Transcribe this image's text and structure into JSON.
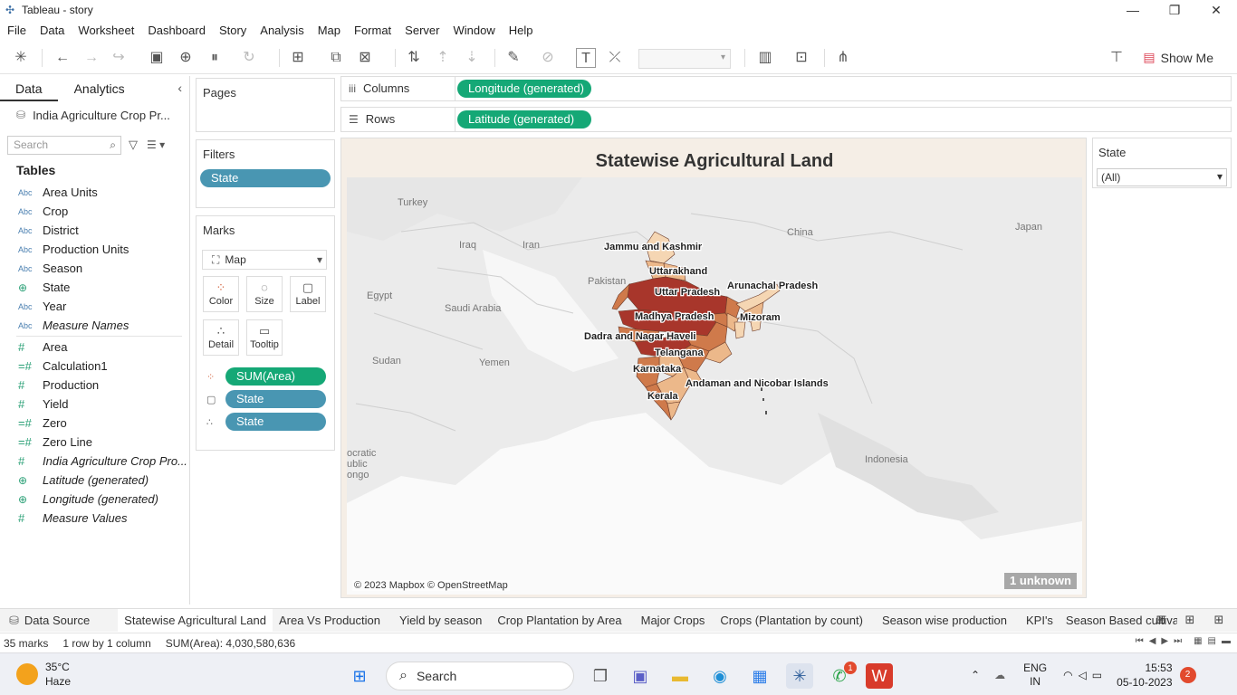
{
  "window": {
    "title": "Tableau - story"
  },
  "menu": [
    "File",
    "Data",
    "Worksheet",
    "Dashboard",
    "Story",
    "Analysis",
    "Map",
    "Format",
    "Server",
    "Window",
    "Help"
  ],
  "toolbar": {
    "show_me": "Show Me"
  },
  "datapane": {
    "tabs": [
      "Data",
      "Analytics"
    ],
    "datasource": "India Agriculture Crop Pr...",
    "search_placeholder": "Search",
    "tables_header": "Tables",
    "dimensions": [
      {
        "type": "Abc",
        "name": "Area Units"
      },
      {
        "type": "Abc",
        "name": "Crop"
      },
      {
        "type": "Abc",
        "name": "District"
      },
      {
        "type": "Abc",
        "name": "Production Units"
      },
      {
        "type": "Abc",
        "name": "Season"
      },
      {
        "type": "geo",
        "name": "State"
      },
      {
        "type": "Abc",
        "name": "Year"
      },
      {
        "type": "Abc",
        "name": "Measure Names",
        "italic": true
      }
    ],
    "measures": [
      {
        "type": "#",
        "name": "Area"
      },
      {
        "type": "=#",
        "name": "Calculation1"
      },
      {
        "type": "#",
        "name": "Production"
      },
      {
        "type": "#",
        "name": "Yield"
      },
      {
        "type": "=#",
        "name": "Zero"
      },
      {
        "type": "=#",
        "name": "Zero Line"
      },
      {
        "type": "#",
        "name": "India Agriculture Crop Pro...",
        "italic": true
      },
      {
        "type": "geo",
        "name": "Latitude (generated)",
        "italic": true
      },
      {
        "type": "geo",
        "name": "Longitude (generated)",
        "italic": true
      },
      {
        "type": "#",
        "name": "Measure Values",
        "italic": true
      }
    ]
  },
  "pages": {
    "label": "Pages"
  },
  "filters": {
    "label": "Filters",
    "pill": "State"
  },
  "marks": {
    "label": "Marks",
    "type": "Map",
    "buttons": [
      "Color",
      "Size",
      "Label",
      "Detail",
      "Tooltip"
    ],
    "pills": [
      "SUM(Area)",
      "State",
      "State"
    ]
  },
  "shelves": {
    "columns_label": "Columns",
    "columns_pill": "Longitude (generated)",
    "rows_label": "Rows",
    "rows_pill": "Latitude (generated)"
  },
  "viz": {
    "title": "Statewise Agricultural  Land",
    "credit": "© 2023 Mapbox © OpenStreetMap",
    "unknown": "1 unknown",
    "bg_labels": [
      "Turkey",
      "Iraq",
      "Iran",
      "Egypt",
      "Saudi Arabia",
      "Pakistan",
      "China",
      "Japan",
      "Sudan",
      "Yemen",
      "Indonesia",
      "ocratic",
      "ublic",
      "ongo"
    ],
    "state_labels": [
      "Jammu and Kashmir",
      "Uttarakhand",
      "Uttar Pradesh",
      "Arunachal Pradesh",
      "Madhya Pradesh",
      "Mizoram",
      "Dadra and Nagar Haveli",
      "Telangana",
      "Karnataka",
      "Andaman and Nicobar Islands",
      "Kerala"
    ],
    "colors": {
      "dark": "#a8362b",
      "mid": "#cf7a4b",
      "light": "#ecb88a",
      "pale": "#f5d6b3"
    }
  },
  "state_filter": {
    "label": "State",
    "value": "(All)"
  },
  "sheet_tabs": [
    "Data Source",
    "Statewise Agricultural Land",
    "Area Vs Production",
    "Yield by season",
    "Crop Plantation by Area",
    "Major  Crops",
    "Crops (Plantation by count)",
    "Season wise production",
    "KPI's",
    "Season Based cultivat"
  ],
  "status": {
    "marks": "35 marks",
    "dims": "1 row by 1 column",
    "sum": "SUM(Area): 4,030,580,636"
  },
  "taskbar": {
    "temp": "35°C",
    "weather": "Haze",
    "search": "Search",
    "lang1": "ENG",
    "lang2": "IN",
    "time": "15:53",
    "date": "05-10-2023",
    "notifications": "2",
    "whatsapp_badge": "1"
  }
}
